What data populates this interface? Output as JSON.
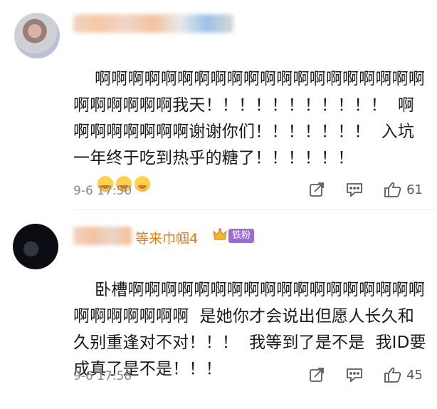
{
  "comments": [
    {
      "text": "啊啊啊啊啊啊啊啊啊啊啊啊啊啊啊啊啊啊啊啊啊啊啊啊啊啊我天！！！！！！！！！！！  啊啊啊啊啊啊啊啊谢谢你们！！！！！！！  入坑一年终于吃到热乎的糖了！！！！！！",
      "emoji": [
        "crying-face",
        "crying-face",
        "crying-face"
      ],
      "time": "9-6 17:50",
      "likes": "61"
    },
    {
      "nickname": "等来巾帼4",
      "badge": "铁粉",
      "text": "卧槽啊啊啊啊啊啊啊啊啊啊啊啊啊啊啊啊啊啊啊啊啊啊啊啊啊  是她你才会说出但愿人长久和久别重逢对不对！！！  我等到了是不是  我ID要成真了是不是！！！",
      "time": "9-6 17:58",
      "likes": "45"
    }
  ],
  "colors": {
    "nickname": "#ea7b19",
    "badge_bg": "#9b6bd6",
    "meta_text": "#8a8a8a"
  },
  "icons": [
    "share-icon",
    "comment-icon",
    "like-icon",
    "crown-icon"
  ]
}
